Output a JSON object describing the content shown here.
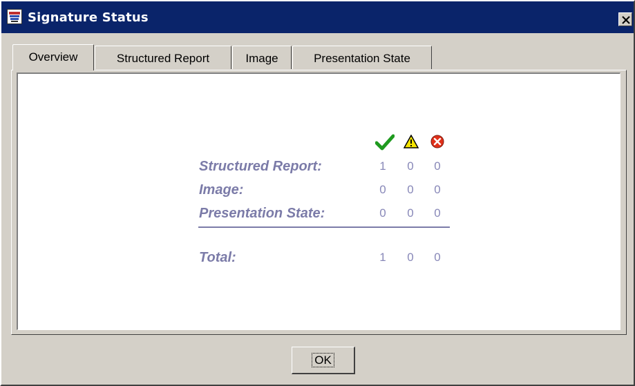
{
  "window": {
    "title": "Signature Status",
    "app_icon": "app-icon",
    "close_icon": "close-icon"
  },
  "tabs": [
    {
      "label": "Overview",
      "active": true
    },
    {
      "label": "Structured Report",
      "active": false
    },
    {
      "label": "Image",
      "active": false
    },
    {
      "label": "Presentation State",
      "active": false
    }
  ],
  "overview": {
    "header_icons": [
      "check-icon",
      "warning-icon",
      "error-icon"
    ],
    "rows": [
      {
        "label": "Structured Report:",
        "valid": "1",
        "warning": "0",
        "error": "0"
      },
      {
        "label": "Image:",
        "valid": "0",
        "warning": "0",
        "error": "0"
      },
      {
        "label": "Presentation State:",
        "valid": "0",
        "warning": "0",
        "error": "0"
      }
    ],
    "total": {
      "label": "Total:",
      "valid": "1",
      "warning": "0",
      "error": "0"
    }
  },
  "buttons": {
    "ok": "OK"
  },
  "colors": {
    "titlebar": "#0a246a",
    "label": "#7b7ba8",
    "check": "#1f9a1f",
    "warning": "#f5e400",
    "error": "#e0301a"
  }
}
